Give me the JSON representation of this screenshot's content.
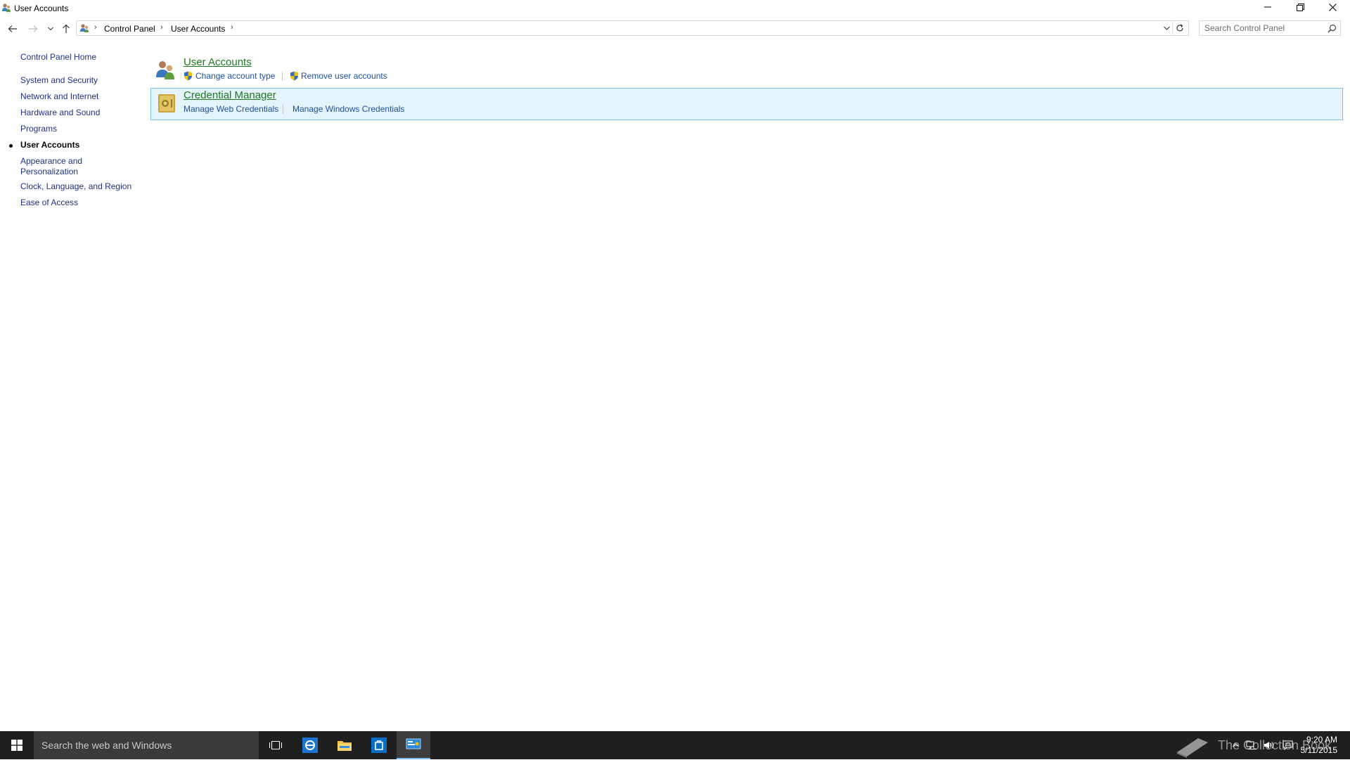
{
  "window": {
    "title": "User Accounts",
    "controls": {
      "minimize": "minimize-icon",
      "restore": "restore-icon",
      "close": "close-icon"
    }
  },
  "address": {
    "breadcrumbs": [
      "Control Panel",
      "User Accounts"
    ],
    "search_placeholder": "Search Control Panel"
  },
  "sidebar": {
    "home": "Control Panel Home",
    "items": [
      {
        "label": "System and Security",
        "current": false
      },
      {
        "label": "Network and Internet",
        "current": false
      },
      {
        "label": "Hardware and Sound",
        "current": false
      },
      {
        "label": "Programs",
        "current": false
      },
      {
        "label": "User Accounts",
        "current": true
      },
      {
        "label": "Appearance and\nPersonalization",
        "current": false
      },
      {
        "label": "Clock, Language, and Region",
        "current": false
      },
      {
        "label": "Ease of Access",
        "current": false
      }
    ]
  },
  "main": {
    "groups": [
      {
        "title": "User Accounts",
        "icon": "users-icon",
        "links": [
          {
            "label": "Change account type",
            "shield": true
          },
          {
            "label": "Remove user accounts",
            "shield": true
          }
        ]
      },
      {
        "title": "Credential Manager",
        "icon": "credential-vault-icon",
        "highlighted": true,
        "links": [
          {
            "label": "Manage Web Credentials",
            "shield": false
          },
          {
            "label": "Manage Windows Credentials",
            "shield": false
          }
        ]
      }
    ]
  },
  "taskbar": {
    "search_text": "Search the web and Windows",
    "apps": [
      "task-view-icon",
      "internet-explorer-icon",
      "file-explorer-icon",
      "store-icon",
      "control-panel-icon"
    ],
    "watermark": "The Collection Book",
    "time": "9:20 AM",
    "date": "5/11/2015"
  },
  "colors": {
    "link": "#1e4f9e",
    "nav_link": "#1e3287",
    "group_title": "#1e7a1e",
    "highlight_bg": "#e5f3fb",
    "highlight_border": "#7dc1e6",
    "taskbar_bg": "#1f1f1f"
  }
}
